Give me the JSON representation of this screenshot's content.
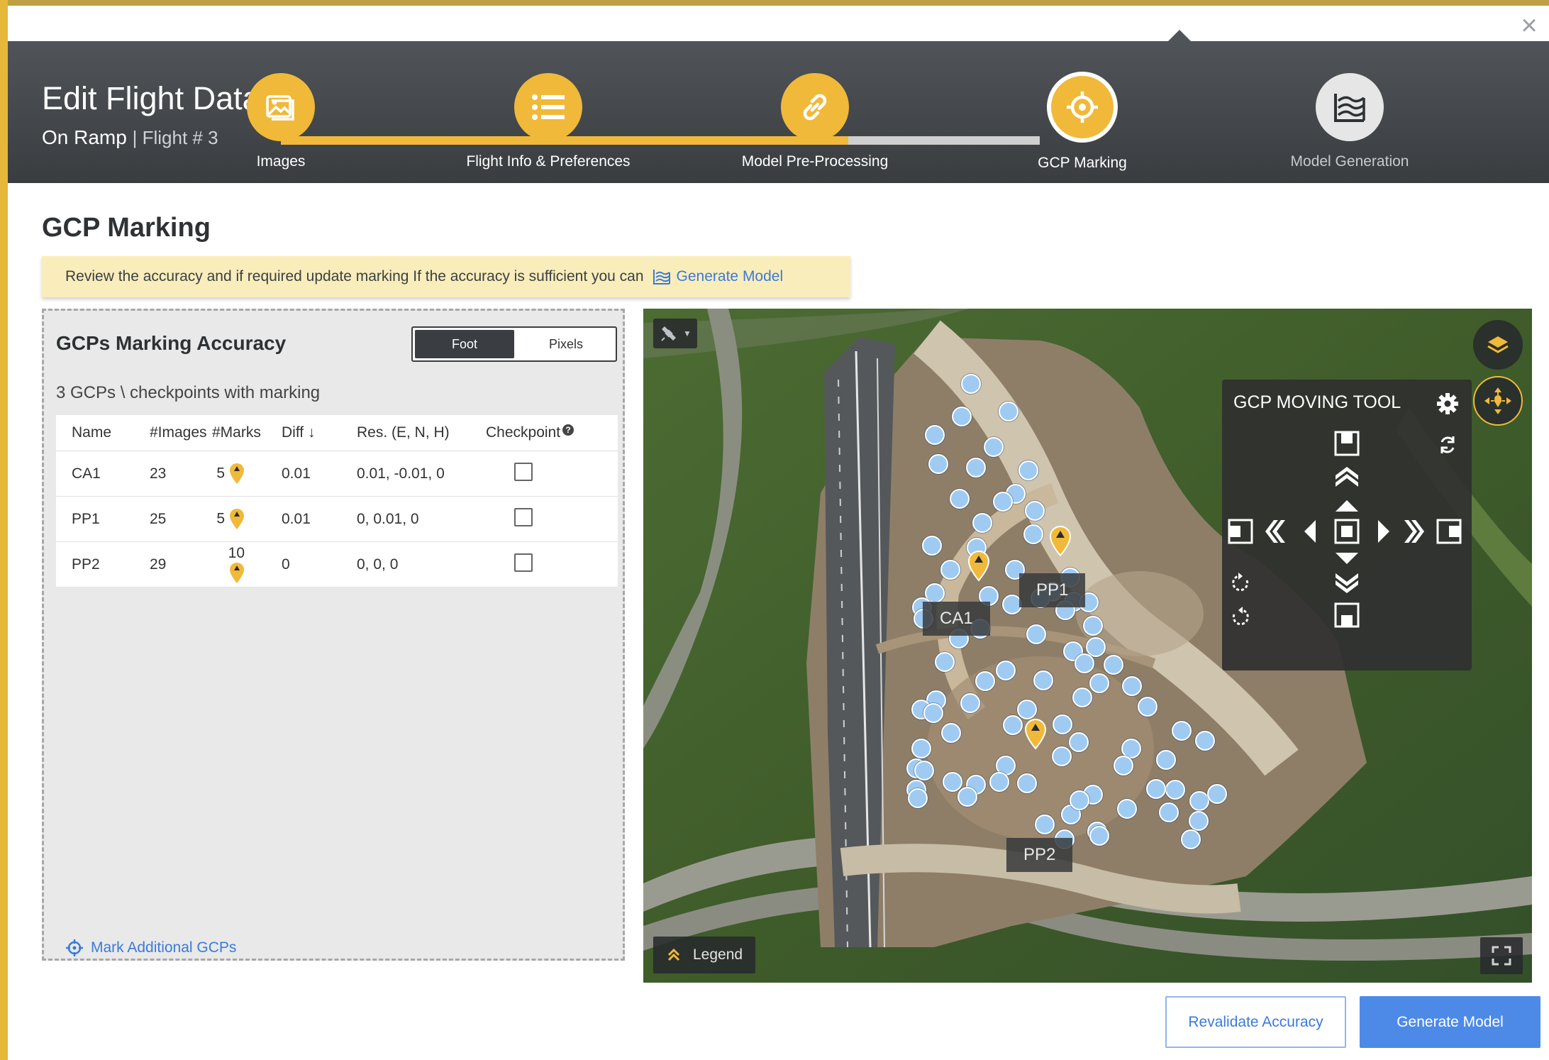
{
  "header": {
    "title": "Edit Flight Data",
    "project": "On Ramp",
    "flight": "| Flight # 3",
    "steps": [
      {
        "label": "Images",
        "icon": "image-icon",
        "state": "done"
      },
      {
        "label": "Flight Info & Preferences",
        "icon": "list-icon",
        "state": "done"
      },
      {
        "label": "Model Pre-Processing",
        "icon": "link-icon",
        "state": "done"
      },
      {
        "label": "GCP Marking",
        "icon": "crosshair-icon",
        "state": "active"
      },
      {
        "label": "Model Generation",
        "icon": "model-icon",
        "state": "todo"
      }
    ]
  },
  "page_title": "GCP Marking",
  "banner": {
    "text": "Review the accuracy and if required update marking If the accuracy is sufficient you can",
    "link": "Generate Model"
  },
  "panel": {
    "title": "GCPs Marking Accuracy",
    "toggle": {
      "selected": "Foot",
      "options": [
        "Foot",
        "Pixels"
      ]
    },
    "count_text": "3 GCPs \\ checkpoints with marking",
    "columns": [
      "Name",
      "#Images",
      "#Marks",
      "Diff",
      "Res. (E, N, H)",
      "Checkpoint"
    ],
    "rows": [
      {
        "name": "CA1",
        "images": "23",
        "marks": "5",
        "diff": "0.01",
        "res": "0.01, -0.01, 0",
        "checkpoint": false
      },
      {
        "name": "PP1",
        "images": "25",
        "marks": "5",
        "diff": "0.01",
        "res": "0, 0.01, 0",
        "checkpoint": false
      },
      {
        "name": "PP2",
        "images": "29",
        "marks": "10",
        "diff": "0",
        "res": "0, 0, 0",
        "checkpoint": false
      }
    ],
    "mark_additional": "Mark Additional GCPs"
  },
  "map": {
    "gcp_labels": [
      "CA1",
      "PP1",
      "PP2"
    ],
    "legend": "Legend",
    "tool": {
      "title": "GCP MOVING TOOL"
    }
  },
  "actions": {
    "revalidate": "Revalidate Accuracy",
    "generate": "Generate Model"
  },
  "colors": {
    "accent": "#f0b93a",
    "link": "#3a7ad9",
    "primary_button": "#4d8ae8",
    "header": "#45484b"
  }
}
